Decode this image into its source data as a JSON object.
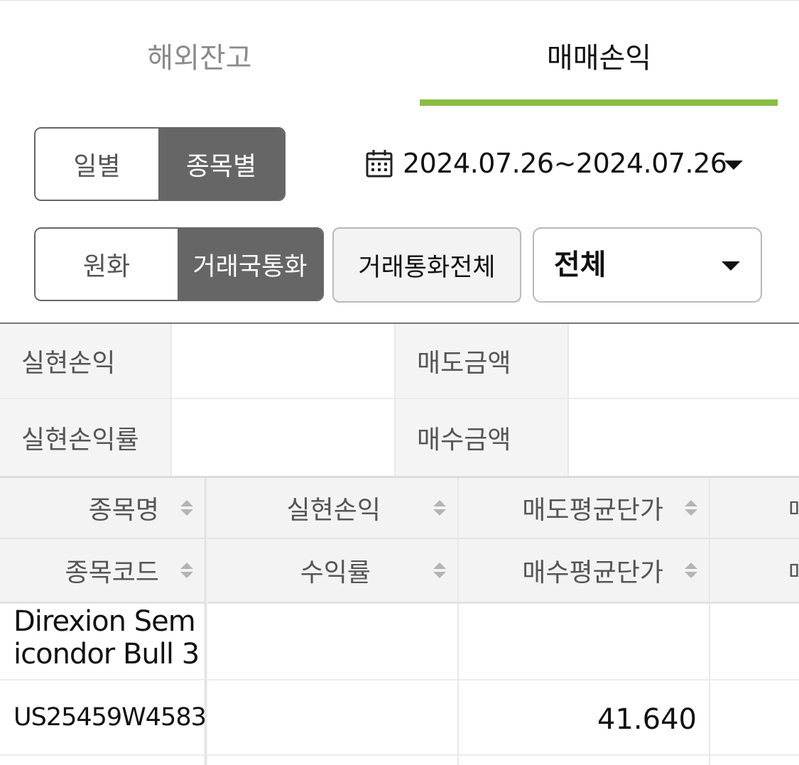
{
  "tabs": {
    "overseas_balance": "해외잔고",
    "trade_pnl": "매매손익"
  },
  "period_toggle": {
    "daily": "일별",
    "by_stock": "종목별",
    "selected": "종목별"
  },
  "date_range": {
    "icon": "calendar-icon",
    "text": "2024.07.26~2024.07.26"
  },
  "currency_toggle": {
    "krw": "원화",
    "trade_currency": "거래국통화",
    "selected": "거래국통화"
  },
  "all_currency_button": "거래통화전체",
  "filter_select": {
    "value": "전체"
  },
  "summary": {
    "realized_pnl_label": "실현손익",
    "realized_pnl_value": "",
    "sell_amount_label": "매도금액",
    "sell_amount_value": "",
    "realized_pnl_rate_label": "실현손익률",
    "realized_pnl_rate_value": "",
    "buy_amount_label": "매수금액",
    "buy_amount_value": ""
  },
  "table": {
    "headers_row1": [
      "종목명",
      "실현손익",
      "매도평균단가",
      "매"
    ],
    "headers_row2": [
      "종목코드",
      "수익률",
      "매수평균단가",
      "매"
    ],
    "rows": [
      {
        "name": "Direxion Semicondor Bull 3",
        "name_line1": "Direxion Sem",
        "name_line2": "icondor Bull 3",
        "code": "US25459W4583",
        "realized_pnl": "",
        "return_rate": "",
        "sell_avg_price": "",
        "buy_avg_price": "41.640"
      }
    ]
  },
  "colors": {
    "accent": "#8bbd45",
    "toggle_on": "#666666"
  }
}
